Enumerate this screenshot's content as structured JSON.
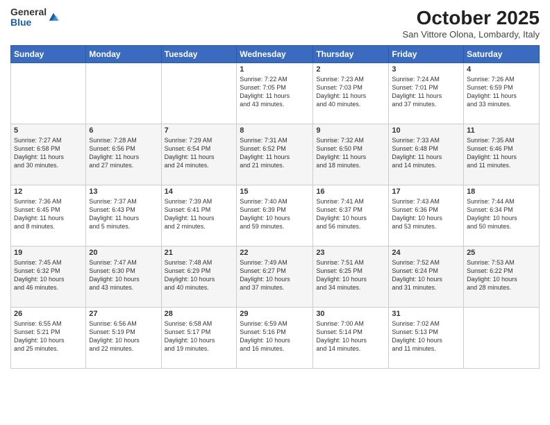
{
  "logo": {
    "general": "General",
    "blue": "Blue"
  },
  "title": "October 2025",
  "location": "San Vittore Olona, Lombardy, Italy",
  "headers": [
    "Sunday",
    "Monday",
    "Tuesday",
    "Wednesday",
    "Thursday",
    "Friday",
    "Saturday"
  ],
  "weeks": [
    [
      {
        "day": "",
        "content": ""
      },
      {
        "day": "",
        "content": ""
      },
      {
        "day": "",
        "content": ""
      },
      {
        "day": "1",
        "content": "Sunrise: 7:22 AM\nSunset: 7:05 PM\nDaylight: 11 hours\nand 43 minutes."
      },
      {
        "day": "2",
        "content": "Sunrise: 7:23 AM\nSunset: 7:03 PM\nDaylight: 11 hours\nand 40 minutes."
      },
      {
        "day": "3",
        "content": "Sunrise: 7:24 AM\nSunset: 7:01 PM\nDaylight: 11 hours\nand 37 minutes."
      },
      {
        "day": "4",
        "content": "Sunrise: 7:26 AM\nSunset: 6:59 PM\nDaylight: 11 hours\nand 33 minutes."
      }
    ],
    [
      {
        "day": "5",
        "content": "Sunrise: 7:27 AM\nSunset: 6:58 PM\nDaylight: 11 hours\nand 30 minutes."
      },
      {
        "day": "6",
        "content": "Sunrise: 7:28 AM\nSunset: 6:56 PM\nDaylight: 11 hours\nand 27 minutes."
      },
      {
        "day": "7",
        "content": "Sunrise: 7:29 AM\nSunset: 6:54 PM\nDaylight: 11 hours\nand 24 minutes."
      },
      {
        "day": "8",
        "content": "Sunrise: 7:31 AM\nSunset: 6:52 PM\nDaylight: 11 hours\nand 21 minutes."
      },
      {
        "day": "9",
        "content": "Sunrise: 7:32 AM\nSunset: 6:50 PM\nDaylight: 11 hours\nand 18 minutes."
      },
      {
        "day": "10",
        "content": "Sunrise: 7:33 AM\nSunset: 6:48 PM\nDaylight: 11 hours\nand 14 minutes."
      },
      {
        "day": "11",
        "content": "Sunrise: 7:35 AM\nSunset: 6:46 PM\nDaylight: 11 hours\nand 11 minutes."
      }
    ],
    [
      {
        "day": "12",
        "content": "Sunrise: 7:36 AM\nSunset: 6:45 PM\nDaylight: 11 hours\nand 8 minutes."
      },
      {
        "day": "13",
        "content": "Sunrise: 7:37 AM\nSunset: 6:43 PM\nDaylight: 11 hours\nand 5 minutes."
      },
      {
        "day": "14",
        "content": "Sunrise: 7:39 AM\nSunset: 6:41 PM\nDaylight: 11 hours\nand 2 minutes."
      },
      {
        "day": "15",
        "content": "Sunrise: 7:40 AM\nSunset: 6:39 PM\nDaylight: 10 hours\nand 59 minutes."
      },
      {
        "day": "16",
        "content": "Sunrise: 7:41 AM\nSunset: 6:37 PM\nDaylight: 10 hours\nand 56 minutes."
      },
      {
        "day": "17",
        "content": "Sunrise: 7:43 AM\nSunset: 6:36 PM\nDaylight: 10 hours\nand 53 minutes."
      },
      {
        "day": "18",
        "content": "Sunrise: 7:44 AM\nSunset: 6:34 PM\nDaylight: 10 hours\nand 50 minutes."
      }
    ],
    [
      {
        "day": "19",
        "content": "Sunrise: 7:45 AM\nSunset: 6:32 PM\nDaylight: 10 hours\nand 46 minutes."
      },
      {
        "day": "20",
        "content": "Sunrise: 7:47 AM\nSunset: 6:30 PM\nDaylight: 10 hours\nand 43 minutes."
      },
      {
        "day": "21",
        "content": "Sunrise: 7:48 AM\nSunset: 6:29 PM\nDaylight: 10 hours\nand 40 minutes."
      },
      {
        "day": "22",
        "content": "Sunrise: 7:49 AM\nSunset: 6:27 PM\nDaylight: 10 hours\nand 37 minutes."
      },
      {
        "day": "23",
        "content": "Sunrise: 7:51 AM\nSunset: 6:25 PM\nDaylight: 10 hours\nand 34 minutes."
      },
      {
        "day": "24",
        "content": "Sunrise: 7:52 AM\nSunset: 6:24 PM\nDaylight: 10 hours\nand 31 minutes."
      },
      {
        "day": "25",
        "content": "Sunrise: 7:53 AM\nSunset: 6:22 PM\nDaylight: 10 hours\nand 28 minutes."
      }
    ],
    [
      {
        "day": "26",
        "content": "Sunrise: 6:55 AM\nSunset: 5:21 PM\nDaylight: 10 hours\nand 25 minutes."
      },
      {
        "day": "27",
        "content": "Sunrise: 6:56 AM\nSunset: 5:19 PM\nDaylight: 10 hours\nand 22 minutes."
      },
      {
        "day": "28",
        "content": "Sunrise: 6:58 AM\nSunset: 5:17 PM\nDaylight: 10 hours\nand 19 minutes."
      },
      {
        "day": "29",
        "content": "Sunrise: 6:59 AM\nSunset: 5:16 PM\nDaylight: 10 hours\nand 16 minutes."
      },
      {
        "day": "30",
        "content": "Sunrise: 7:00 AM\nSunset: 5:14 PM\nDaylight: 10 hours\nand 14 minutes."
      },
      {
        "day": "31",
        "content": "Sunrise: 7:02 AM\nSunset: 5:13 PM\nDaylight: 10 hours\nand 11 minutes."
      },
      {
        "day": "",
        "content": ""
      }
    ]
  ]
}
